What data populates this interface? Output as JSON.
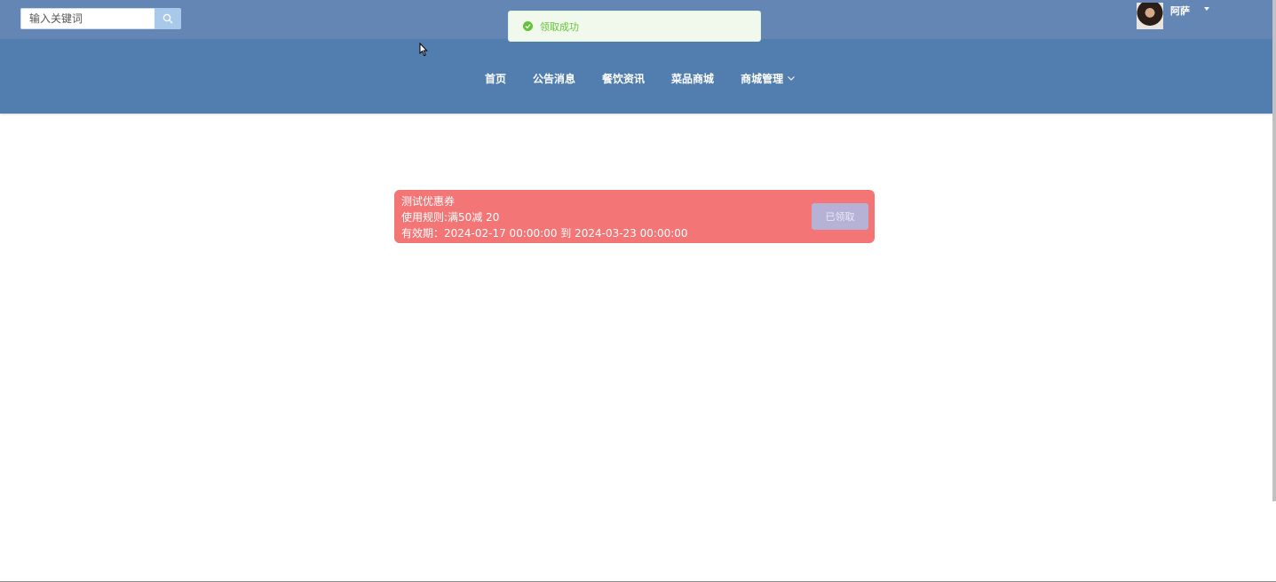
{
  "search": {
    "placeholder": "输入关键词",
    "icon": "search-icon"
  },
  "toast": {
    "message": "领取成功",
    "icon": "check-circle-icon",
    "color": "#67c23a"
  },
  "user": {
    "name": "阿萨"
  },
  "nav": {
    "items": [
      {
        "label": "首页"
      },
      {
        "label": "公告消息"
      },
      {
        "label": "餐饮资讯"
      },
      {
        "label": "菜品商城"
      },
      {
        "label": "商城管理"
      }
    ]
  },
  "coupon": {
    "title": "测试优惠券",
    "rule": "使用规则:满50减 20",
    "validity": "有效期：2024-02-17 00:00:00 到 2024-03-23 00:00:00",
    "status": "已领取",
    "color": "#f37575"
  },
  "colors": {
    "topbar": "#6486b5",
    "navbar": "#517daf"
  }
}
